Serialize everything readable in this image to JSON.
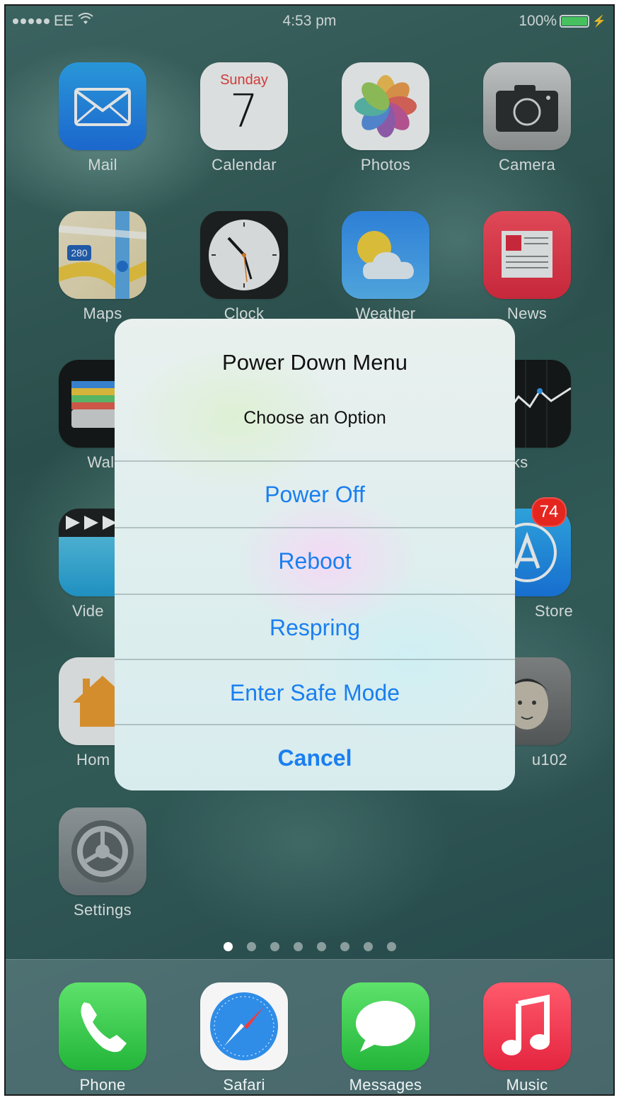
{
  "status_bar": {
    "carrier": "EE",
    "time": "4:53 pm",
    "battery_percent": "100%",
    "signal_bars": 5,
    "wifi_icon": "wifi-icon",
    "charging_icon": "bolt-icon"
  },
  "home_apps": [
    {
      "label": "Mail",
      "icon": "mail-icon"
    },
    {
      "label": "Calendar",
      "icon": "calendar-icon",
      "day": "Sunday",
      "date": "7"
    },
    {
      "label": "Photos",
      "icon": "photos-icon"
    },
    {
      "label": "Camera",
      "icon": "camera-icon"
    },
    {
      "label": "Maps",
      "icon": "maps-icon",
      "route_shield": "280"
    },
    {
      "label": "Clock",
      "icon": "clock-icon"
    },
    {
      "label": "Weather",
      "icon": "weather-icon"
    },
    {
      "label": "News",
      "icon": "news-icon"
    },
    {
      "label": "Wall",
      "icon": "wallet-icon"
    },
    {
      "label": "ocks",
      "icon": "stocks-icon"
    },
    {
      "label": "Vide",
      "icon": "videos-icon"
    },
    {
      "label": "Store",
      "icon": "app-store-icon",
      "badge": "74"
    },
    {
      "label": "Hom",
      "icon": "home-icon"
    },
    {
      "label": "u102",
      "icon": "photo-icon"
    },
    {
      "label": "Settings",
      "icon": "settings-icon"
    }
  ],
  "dock_apps": [
    {
      "label": "Phone",
      "icon": "phone-icon"
    },
    {
      "label": "Safari",
      "icon": "safari-icon"
    },
    {
      "label": "Messages",
      "icon": "messages-icon"
    },
    {
      "label": "Music",
      "icon": "music-icon"
    }
  ],
  "page_indicator": {
    "count": 8,
    "active": 1
  },
  "alert": {
    "title": "Power Down Menu",
    "message": "Choose an Option",
    "buttons": [
      "Power Off",
      "Reboot",
      "Respring",
      "Enter Safe Mode",
      "Cancel"
    ]
  },
  "colors": {
    "button_text": "#1a7ff0",
    "badge": "#e5261f"
  }
}
